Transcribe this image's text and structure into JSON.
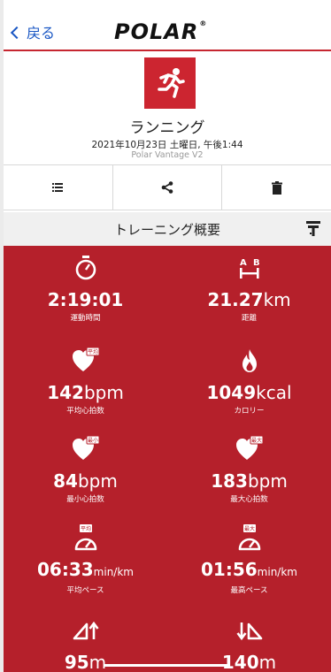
{
  "nav": {
    "back_label": "戻る",
    "brand": "POLAR",
    "brand_mark": "®"
  },
  "activity": {
    "sport_name": "ランニング",
    "datetime": "2021年10月23日 土曜日, 午後1:44",
    "device": "Polar Vantage V2"
  },
  "actions": [
    {
      "icon": "list-icon"
    },
    {
      "icon": "share-icon"
    },
    {
      "icon": "trash-icon"
    }
  ],
  "summary": {
    "title": "トレーニング概要",
    "stats": [
      {
        "icon": "stopwatch-icon",
        "value": "2:19:01",
        "unit": "",
        "label": "運動時間"
      },
      {
        "icon": "distance-icon",
        "value": "21.27",
        "unit": "km",
        "label": "距離"
      },
      {
        "icon": "heart-avg-icon",
        "badge": "平均",
        "value": "142",
        "unit": "bpm",
        "label": "平均心拍数"
      },
      {
        "icon": "flame-icon",
        "value": "1049",
        "unit": "kcal",
        "label": "カロリー"
      },
      {
        "icon": "heart-min-icon",
        "badge": "最小",
        "value": "84",
        "unit": "bpm",
        "label": "最小心拍数"
      },
      {
        "icon": "heart-max-icon",
        "badge": "最大",
        "value": "183",
        "unit": "bpm",
        "label": "最大心拍数"
      },
      {
        "icon": "pace-avg-icon",
        "badge": "平均",
        "value": "06:33",
        "unit": "min/km",
        "label": "平均ペース"
      },
      {
        "icon": "pace-max-icon",
        "badge": "最大",
        "value": "01:56",
        "unit": "min/km",
        "label": "最高ペース"
      },
      {
        "icon": "ascent-icon",
        "value": "95",
        "unit": "m",
        "label": ""
      },
      {
        "icon": "descent-icon",
        "value": "140",
        "unit": "m",
        "label": ""
      }
    ]
  },
  "colors": {
    "brand_red": "#cc2530",
    "panel_red": "#b5202b",
    "link_blue": "#1a57c4"
  }
}
